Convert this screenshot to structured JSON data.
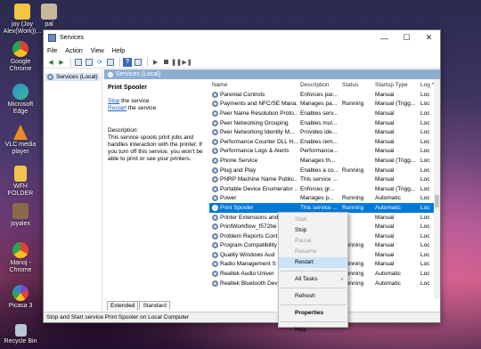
{
  "desktop": {
    "icons": [
      {
        "label": "joy (Joy Alex(Work))...",
        "color": "#f5c444"
      },
      {
        "label": "pal",
        "color": "#c8b89a"
      },
      {
        "label": "Google Chrome",
        "color": "#e34133"
      },
      {
        "label": "Microsoft Edge",
        "color": "#2f8ad6"
      },
      {
        "label": "VLC media player",
        "color": "#f08a1c"
      },
      {
        "label": "WFH FOLDER",
        "color": "#f3c44c"
      },
      {
        "label": "joyalex",
        "color": "#8a6a4a"
      },
      {
        "label": "Manoj - Chrome",
        "color": "#e34133"
      },
      {
        "label": "Picasa 3",
        "color": "#7c4bc9"
      },
      {
        "label": "Recycle Bin",
        "color": "#b8c7d8"
      }
    ]
  },
  "window": {
    "title": "Services",
    "controls": {
      "minimize": "—",
      "maximize": "☐",
      "close": "✕"
    },
    "menu": [
      "File",
      "Action",
      "View",
      "Help"
    ]
  },
  "tree": {
    "root": "Services (Local)"
  },
  "header": {
    "title": "Services (Local)"
  },
  "details": {
    "service_name": "Print Spooler",
    "stop_link": "Stop",
    "stop_suffix": " the service",
    "restart_link": "Restart",
    "restart_suffix": " the service",
    "description_label": "Description:",
    "description": "This service spools print jobs and handles interaction with the printer. If you turn off this service, you won't be able to print or see your printers."
  },
  "columns": {
    "name": "Name",
    "description": "Description",
    "status": "Status",
    "startup": "Startup Type",
    "logon": "Log ^"
  },
  "rows": [
    [
      "Parental Controls",
      "Enforces par...",
      "",
      "Manual",
      "Loc"
    ],
    [
      "Payments and NFC/SE Mana...",
      "Manages pa...",
      "Running",
      "Manual (Trigg...",
      "Loc"
    ],
    [
      "Peer Name Resolution Proto...",
      "Enables serv...",
      "",
      "Manual",
      "Loc"
    ],
    [
      "Peer Networking Grouping",
      "Enables mul...",
      "",
      "Manual",
      "Loc"
    ],
    [
      "Peer Networking Identity M...",
      "Provides ide...",
      "",
      "Manual",
      "Loc"
    ],
    [
      "Performance Counter DLL H...",
      "Enables rem...",
      "",
      "Manual",
      "Loc"
    ],
    [
      "Performance Logs & Alerts",
      "Performance...",
      "",
      "Manual",
      "Loc"
    ],
    [
      "Phone Service",
      "Manages th...",
      "",
      "Manual (Trigg...",
      "Loc"
    ],
    [
      "Plug and Play",
      "Enables a co...",
      "Running",
      "Manual",
      "Loc"
    ],
    [
      "PNRP Machine Name Public...",
      "This service ...",
      "",
      "Manual",
      "Loc"
    ],
    [
      "Portable Device Enumerator ...",
      "Enforces gr...",
      "",
      "Manual (Trigg...",
      "Loc"
    ],
    [
      "Power",
      "Manages p...",
      "Running",
      "Automatic",
      "Loc"
    ],
    [
      "Print Spooler",
      "This service ...",
      "Running",
      "Automatic",
      "Loc"
    ],
    [
      "Printer Extensions and",
      "",
      "",
      "Manual",
      "Loc"
    ],
    [
      "PrintWorkflow_f572be",
      "",
      "",
      "Manual",
      "Loc"
    ],
    [
      "Problem Reports Cont",
      "",
      "",
      "Manual",
      "Loc"
    ],
    [
      "Program Compatibility",
      "",
      "Running",
      "Manual",
      "Loc"
    ],
    [
      "Quality Windows Aud",
      "",
      "",
      "Manual",
      "Loc"
    ],
    [
      "Radio Management S",
      "",
      "Running",
      "Manual",
      "Loc"
    ],
    [
      "Realtek Audio Univer",
      "",
      "Running",
      "Automatic",
      "Loc"
    ],
    [
      "Realtek Bluetooth Dev",
      "",
      "Running",
      "Automatic",
      "Loc"
    ]
  ],
  "selected_row": 12,
  "tabs": [
    "Extended",
    "Standard"
  ],
  "status_text": "Stop and Start service Print Spooler on Local Computer",
  "context_menu": {
    "start": "Start",
    "stop": "Stop",
    "pause": "Pause",
    "resume": "Resume",
    "restart": "Restart",
    "all_tasks": "All Tasks",
    "refresh": "Refresh",
    "properties": "Properties",
    "help": "Help"
  },
  "colors": {
    "selection": "#0078d7",
    "header_band": "#8eaed1",
    "menu_hover": "#cce4f7"
  }
}
